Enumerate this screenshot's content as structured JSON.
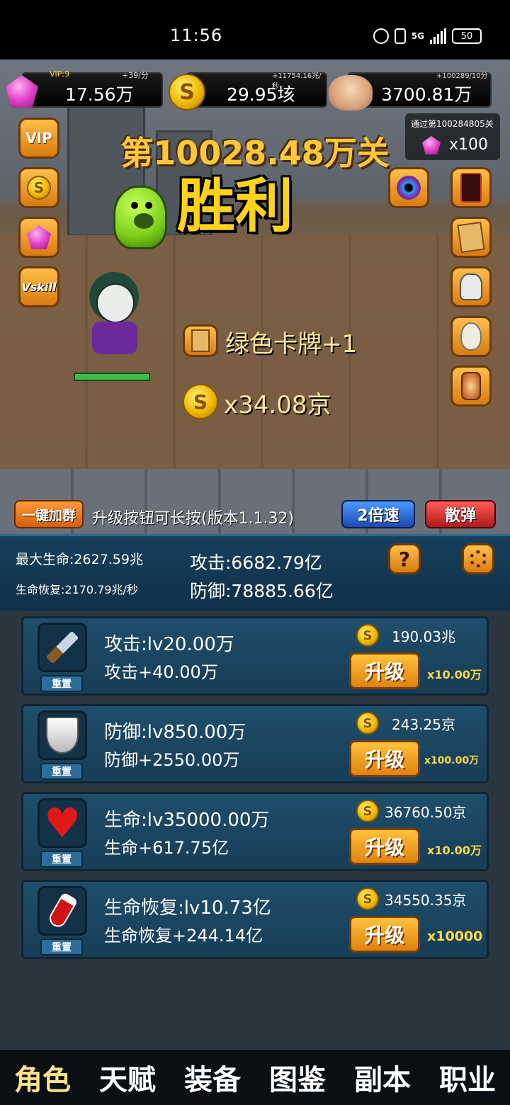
{
  "status_bar": {
    "time": "11:56",
    "network": "5G",
    "battery": "50"
  },
  "resources": {
    "vip_level": "VIP:9",
    "gem_rate": "+39/分",
    "gems": "17.56万",
    "coin_rate": "+11754.16兆/秒",
    "coins": "29.95垓",
    "skull_rate": "+100289/10分",
    "skulls": "3700.81万"
  },
  "stage": {
    "title": "第10028.48万关",
    "result": "胜利",
    "pass_label": "通过第100284805关",
    "pass_reward": "x100"
  },
  "left_buttons": [
    "VIP",
    "coin",
    "gem",
    "Vskill"
  ],
  "rewards": {
    "card": "绿色卡牌+1",
    "coins": "x34.08京"
  },
  "actions": {
    "join_group": "一键加群",
    "tip": "升级按钮可长按(版本1.1.32)",
    "speed": "2倍速",
    "scatter": "散弹"
  },
  "stats": {
    "max_hp": "最大生命:2627.59兆",
    "hp_regen": "生命恢复:2170.79兆/秒",
    "attack": "攻击:6682.79亿",
    "defense": "防御:78885.66亿",
    "help": "?"
  },
  "upgrades": [
    {
      "icon": "dagger-icon",
      "name": "攻击:lv20.00万",
      "effect": "攻击+40.00万",
      "cost": "190.03兆",
      "button": "升级",
      "mult": "x10.00万",
      "reset": "重置"
    },
    {
      "icon": "shield-icon",
      "name": "防御:lv850.00万",
      "effect": "防御+2550.00万",
      "cost": "243.25京",
      "button": "升级",
      "mult": "x100.00万",
      "reset": "重置"
    },
    {
      "icon": "heart-icon",
      "name": "生命:lv35000.00万",
      "effect": "生命+617.75亿",
      "cost": "36760.50京",
      "button": "升级",
      "mult": "x10.00万",
      "reset": "重置"
    },
    {
      "icon": "potion-icon",
      "name": "生命恢复:lv10.73亿",
      "effect": "生命恢复+244.14亿",
      "cost": "34550.35京",
      "button": "升级",
      "mult": "x10000",
      "reset": "重置"
    }
  ],
  "nav": [
    "角色",
    "天赋",
    "装备",
    "图鉴",
    "副本",
    "职业"
  ],
  "colors": {
    "accent": "#ffc83a",
    "button": "#e08210",
    "panel": "#1f4e6c"
  }
}
